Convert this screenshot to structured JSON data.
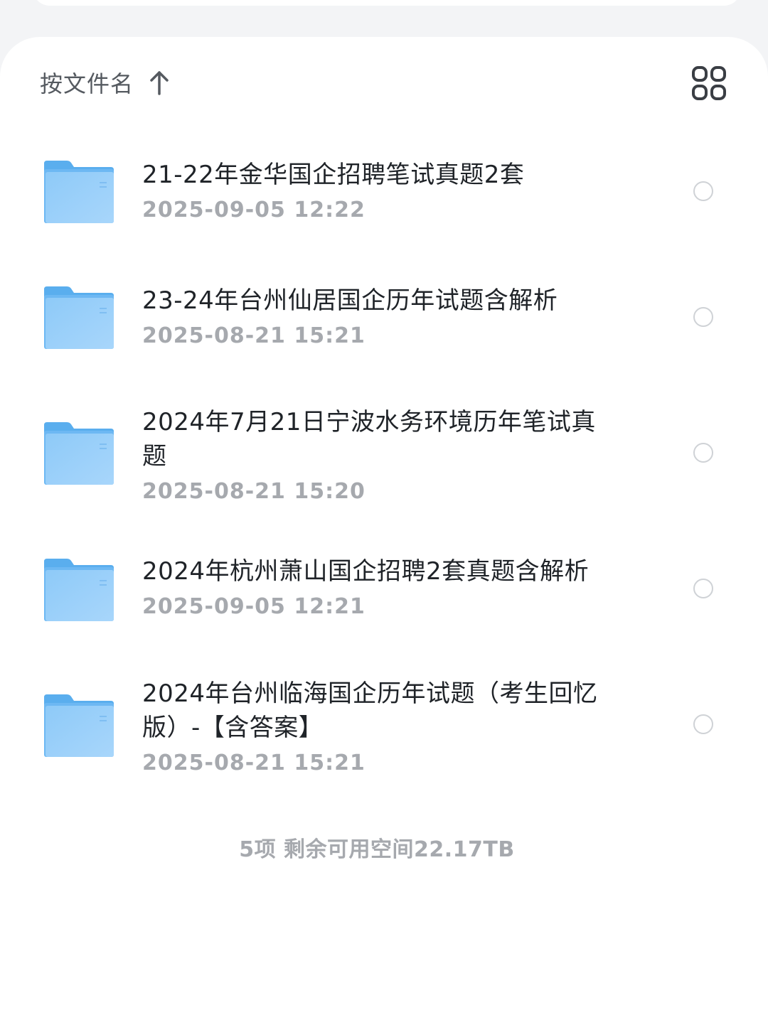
{
  "sort": {
    "label": "按文件名",
    "direction_icon": "arrow-up-icon"
  },
  "view_toggle": {
    "icon": "grid-view-icon"
  },
  "files": [
    {
      "name": "21-22年金华国企招聘笔试真题2套",
      "time": "2025-09-05 12:22"
    },
    {
      "name": "23-24年台州仙居国企历年试题含解析",
      "time": "2025-08-21 15:21"
    },
    {
      "name": "2024年7月21日宁波水务环境历年笔试真题",
      "time": "2025-08-21 15:20"
    },
    {
      "name": "2024年杭州萧山国企招聘2套真题含解析",
      "time": "2025-09-05 12:21"
    },
    {
      "name": "2024年台州临海国企历年试题（考生回忆版）-【含答案】",
      "time": "2025-08-21 15:21"
    }
  ],
  "footer": {
    "summary": "5项 剩余可用空间22.17TB"
  },
  "colors": {
    "folder_light": "#8fcaf8",
    "folder_dark": "#5fb0f0",
    "text_primary": "#1f2328",
    "text_secondary": "#a6a9ae"
  }
}
